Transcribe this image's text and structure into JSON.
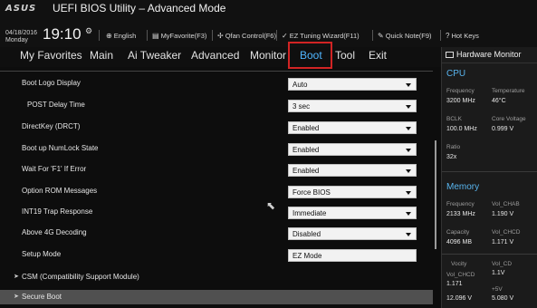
{
  "header": {
    "logo": "ASUS",
    "title": "UEFI BIOS Utility – Advanced Mode",
    "date": "04/18/2016",
    "day": "Monday",
    "time": "19:10",
    "toolbar": [
      {
        "icon": "globe-icon",
        "label": "English"
      },
      {
        "icon": "favorite-icon",
        "label": "MyFavorite(F3)"
      },
      {
        "icon": "fan-icon",
        "label": "Qfan Control(F6)"
      },
      {
        "icon": "wizard-icon",
        "label": "EZ Tuning Wizard(F11)"
      },
      {
        "icon": "note-icon",
        "label": "Quick Note(F9)"
      },
      {
        "icon": "help-icon",
        "label": "Hot Keys"
      }
    ]
  },
  "nav": {
    "tabs": [
      "My Favorites",
      "Main",
      "Ai Tweaker",
      "Advanced",
      "Monitor",
      "Boot",
      "Tool",
      "Exit"
    ],
    "active": "Boot"
  },
  "settings": [
    {
      "label": "Boot Logo Display",
      "value": "Auto",
      "type": "select"
    },
    {
      "label": "POST Delay Time",
      "value": "3 sec",
      "type": "select"
    },
    {
      "label": "DirectKey (DRCT)",
      "value": "Enabled",
      "type": "select"
    },
    {
      "label": "Boot up NumLock State",
      "value": "Enabled",
      "type": "select"
    },
    {
      "label": "Wait For 'F1' If Error",
      "value": "Enabled",
      "type": "select"
    },
    {
      "label": "Option ROM Messages",
      "value": "Force BIOS",
      "type": "select"
    },
    {
      "label": "INT19 Trap Response",
      "value": "Immediate",
      "type": "select"
    },
    {
      "label": "Above 4G Decoding",
      "value": "Disabled",
      "type": "select"
    },
    {
      "label": "Setup Mode",
      "value": "EZ Mode",
      "type": "text"
    }
  ],
  "submenus": [
    {
      "label": "CSM (Compatibility Support Module)"
    },
    {
      "label": "Secure Boot"
    }
  ],
  "hardware_monitor": {
    "title": "Hardware Monitor",
    "cpu": {
      "heading": "CPU",
      "frequency_label": "Frequency",
      "frequency": "3200 MHz",
      "temperature_label": "Temperature",
      "temperature": "46°C",
      "bclk_label": "BCLK",
      "bclk": "100.0 MHz",
      "core_voltage_label": "Core Voltage",
      "core_voltage": "0.999 V",
      "ratio_label": "Ratio",
      "ratio": "32x"
    },
    "memory": {
      "heading": "Memory",
      "frequency_label": "Frequency",
      "frequency": "2133 MHz",
      "vol_chab_label": "Vol_CHAB",
      "vol_chab": "1.190 V",
      "capacity_label": "Capacity",
      "capacity": "4096 MB",
      "vol_chcd_label": "Vol_CHCD",
      "vol_chcd": "1.171 V"
    },
    "voltage": {
      "label_a": "Vocity",
      "label_b": "Vol_CD",
      "label_c": "Vol_CHCD",
      "value_b": "1.1V",
      "value_a": "1.171",
      "label_d": "+5V",
      "value_c": "12.096 V",
      "value_d": "5.080 V"
    }
  },
  "colors": {
    "accent": "#4fb6ff",
    "highlight_box": "#d12424",
    "background": "#0d0d0d"
  }
}
